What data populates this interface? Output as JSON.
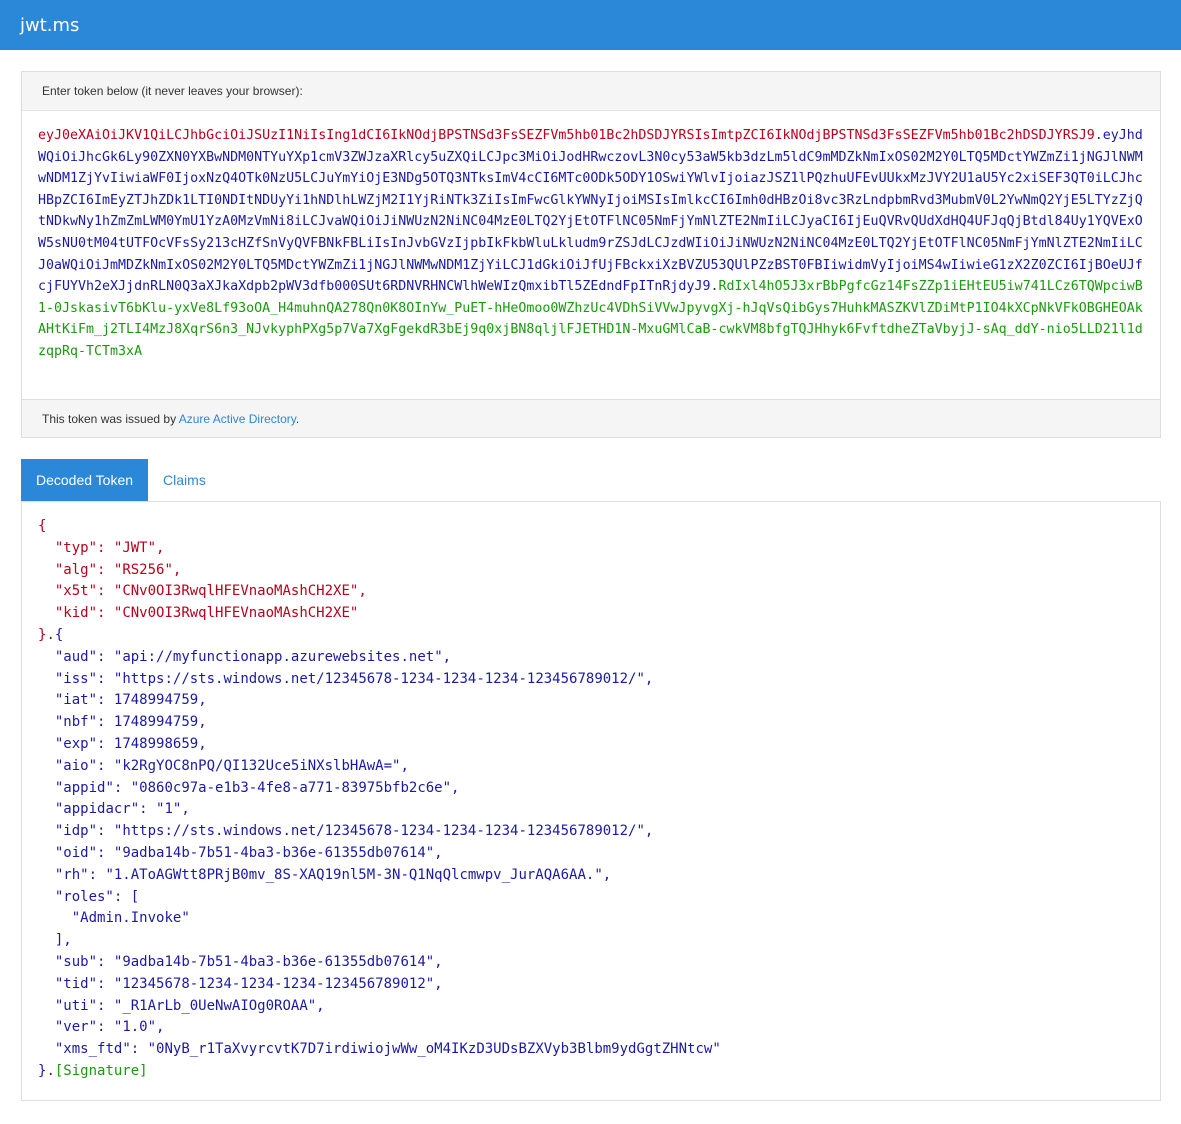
{
  "app": {
    "title": "jwt.ms"
  },
  "token_panel": {
    "instructions": "Enter token below (it never leaves your browser):",
    "header_part": "eyJ0eXAiOiJKV1QiLCJhbGciOiJSUzI1NiIsIng1dCI6IkNOdjBPSTNSd3FsSEZFVm5hb01Bc2hDSDJYRSIsImtpZCI6IkNOdjBPSTNSd3FsSEZFVm5hb01Bc2hDSDJYRSJ9",
    "payload_part": "eyJhdWQiOiJhcGk6Ly90ZXN0YXBwNDM0NTYuYXp1cmV3ZWJzaXRlcy5uZXQiLCJpc3MiOiJodHRwczovL3N0cy53aW5kb3dzLm5ldC9mMDZkNmIxOS02M2Y0LTQ5MDctYWZmZi1jNGJlNWMwNDM1ZjYvIiwiaWF0IjoxNzQ4OTk0NzU5LCJuYmYiOjE3NDg5OTQ3NTksImV4cCI6MTc0ODk5ODY1OSwiYWlvIjoiazJSZ1lPQzhuUFEvUUkxMzJVY2U1aU5Yc2xiSEF3QT0iLCJhcHBpZCI6ImEyZTJhZDk1LTI0NDItNDUyYi1hNDlhLWZjM2I1YjRiNTk3ZiIsImFwcGlkYWNyIjoiMSIsImlkcCI6Imh0dHBzOi8vc3RzLndpbmRvd3MubmV0L2YwNmQ2YjE5LTYzZjQtNDkwNy1hZmZmLWM0YmU1YzA0MzVmNi8iLCJvaWQiOiJiNWUzN2NiNC04MzE0LTQ2YjEtOTFlNC05NmFjYmNlZTE2NmIiLCJyaCI6IjEuQVRvQUdXdHQ4UFJqQjBtdl84Uy1YQVExOW5sNU0tM04tUTFOcVFsSy213cHZfSnVyQVFBNkFBLiIsInJvbGVzIjpbIkFkbWluLkludm9rZSJdLCJzdWIiOiJiNWUzN2NiNC04MzE0LTQ2YjEtOTFlNC05NmFjYmNlZTE2NmIiLCJ0aWQiOiJmMDZkNmIxOS02M2Y0LTQ5MDctYWZmZi1jNGJlNWMwNDM1ZjYiLCJ1dGkiOiJfUjFBckxiXzBVZU53QUlPZzBST0FBIiwidmVyIjoiMS4wIiwieG1zX2Z0ZCI6IjBOeUJfcjFUYVh2eXJjdnRLN0Q3aXJkaXdpb2pWV3dfb000SUt6RDNVRHNCWlhWeWIzQmxibTl5ZEdndFpITnRjdyJ9",
    "signature_part": "RdIxl4hO5J3xrBbPgfcGz14FsZZp1iEHtEU5iw741LCz6TQWpciwB1-0JskasivT6bKlu-yxVe8Lf93oOA_H4muhnQA278Qn0K8OInYw_PuET-hHeOmoo0WZhzUc4VDhSiVVwJpyvgXj-hJqVsQibGys7HuhkMASZKVlZDiMtP1IO4kXCpNkVFkOBGHEOAkAHtKiFm_j2TLI4MzJ8XqrS6n3_NJvkyphPXg5p7Va7XgFgekdR3bEj9q0xjBN8qljlFJETHD1N-MxuGMlCaB-cwkVM8bfgTQJHhyk6FvftdheZTaVbyjJ-sAq_ddY-nio5LLD21l1dzqpRq-TCTm3xA",
    "footer_prefix": "This token was issued by ",
    "issuer_link": "Azure Active Directory",
    "footer_suffix": "."
  },
  "tabs": [
    {
      "label": "Decoded Token",
      "active": true
    },
    {
      "label": "Claims",
      "active": false
    }
  ],
  "decoded": {
    "header": [
      {
        "key": "typ",
        "value": "JWT"
      },
      {
        "key": "alg",
        "value": "RS256"
      },
      {
        "key": "x5t",
        "value": "CNv0OI3RwqlHFEVnaoMAshCH2XE"
      },
      {
        "key": "kid",
        "value": "CNv0OI3RwqlHFEVnaoMAshCH2XE"
      }
    ],
    "payload": [
      {
        "key": "aud",
        "value": "api://myfunctionapp.azurewebsites.net"
      },
      {
        "key": "iss",
        "value": "https://sts.windows.net/12345678-1234-1234-1234-123456789012/"
      },
      {
        "key": "iat",
        "value": 1748994759
      },
      {
        "key": "nbf",
        "value": 1748994759
      },
      {
        "key": "exp",
        "value": 1748998659
      },
      {
        "key": "aio",
        "value": "k2RgYOC8nPQ/QI132Uce5iNXslbHAwA="
      },
      {
        "key": "appid",
        "value": "0860c97a-e1b3-4fe8-a771-83975bfb2c6e"
      },
      {
        "key": "appidacr",
        "value": "1"
      },
      {
        "key": "idp",
        "value": "https://sts.windows.net/12345678-1234-1234-1234-123456789012/"
      },
      {
        "key": "oid",
        "value": "9adba14b-7b51-4ba3-b36e-61355db07614"
      },
      {
        "key": "rh",
        "value": "1.AToAGWtt8PRjB0mv_8S-XAQ19nl5M-3N-Q1NqQlcmwpv_JurAQA6AA."
      },
      {
        "key": "roles",
        "value": [
          "Admin.Invoke"
        ]
      },
      {
        "key": "sub",
        "value": "9adba14b-7b51-4ba3-b36e-61355db07614"
      },
      {
        "key": "tid",
        "value": "12345678-1234-1234-1234-123456789012"
      },
      {
        "key": "uti",
        "value": "_R1ArLb_0UeNwAIOg0ROAA"
      },
      {
        "key": "ver",
        "value": "1.0"
      },
      {
        "key": "xms_ftd",
        "value": "0NyB_r1TaXvyrcvtK7D7irdiwiojwWw_oM4IKzD3UDsBZXVyb3Blbm9ydGgtZHNtcw"
      }
    ],
    "signature_label": "[Signature]"
  }
}
